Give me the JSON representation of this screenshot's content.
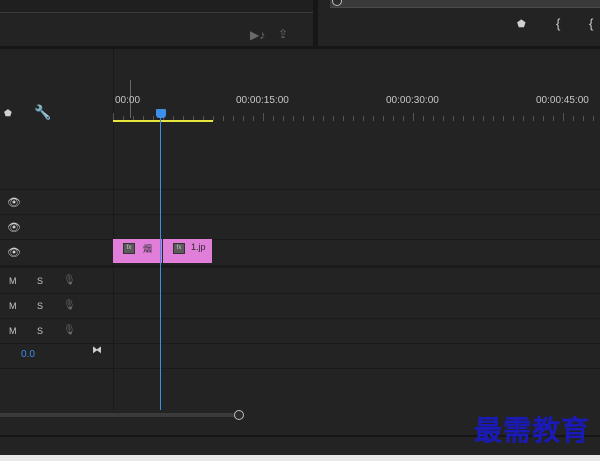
{
  "ruler": {
    "timecodes": [
      "00:00",
      "00:00:15:00",
      "00:00:30:00",
      "00:00:45:00"
    ]
  },
  "tracks": {
    "video": [
      {
        "eye_icon": "eye-icon"
      },
      {
        "eye_icon": "eye-icon"
      },
      {
        "eye_icon": "eye-icon"
      }
    ],
    "audio": [
      {
        "mute": "M",
        "solo": "S"
      },
      {
        "mute": "M",
        "solo": "S"
      },
      {
        "mute": "M",
        "solo": "S"
      }
    ],
    "master_volume": "0.0"
  },
  "clips": [
    {
      "label": "烟",
      "fx": "fx"
    },
    {
      "label": "1.jp",
      "fx": "fx"
    }
  ],
  "colors": {
    "clip": "#e07ed9",
    "playhead": "#3d8ee8",
    "work_area": "#e6e63c"
  },
  "watermark": "最需教育"
}
